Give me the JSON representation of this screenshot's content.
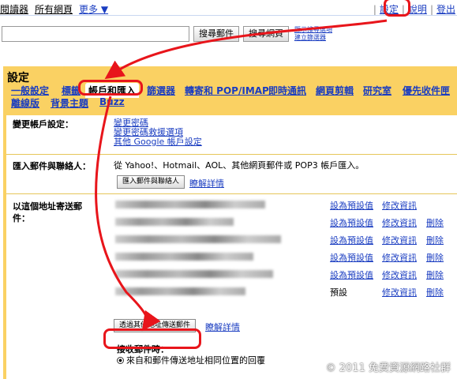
{
  "topbar": {
    "left_items": [
      "閱讀器",
      "所有網頁",
      "更多 ▼"
    ],
    "right_items": [
      "設定",
      "說明",
      "登出"
    ]
  },
  "search": {
    "value": "",
    "mail_button": "搜尋郵件",
    "web_button": "搜尋網頁",
    "options": [
      "顯示搜尋選項",
      "建立篩選器"
    ]
  },
  "settings": {
    "title": "設定",
    "tabs": [
      "一般設定",
      "標籤",
      "帳戶和匯入",
      "篩選器",
      "轉寄和 POP/IMAP",
      "即時通訊",
      "網頁剪輯",
      "研究室",
      "優先收件匣",
      "離線版",
      "背景主題",
      "Buzz"
    ],
    "change_account": {
      "label": "變更帳戶設定：",
      "links": [
        "變更密碼",
        "變更密碼救援選項",
        "其他 Google 帳戶設定"
      ]
    },
    "import": {
      "label": "匯入郵件與聯絡人：",
      "text": "從 Yahoo!、Hotmail、AOL、其他網頁郵件或 POP3 帳戶匯入。",
      "button": "匯入郵件與聯絡人",
      "learn_more": "瞭解詳情"
    },
    "send_as": {
      "label_line1": "以這個地址寄送郵",
      "label_line2": "件：",
      "rows": [
        {
          "set_default": "設為預設值",
          "edit": "修改資訊",
          "delete": ""
        },
        {
          "set_default": "設為預設值",
          "edit": "修改資訊",
          "delete": "刪除"
        },
        {
          "set_default": "設為預設值",
          "edit": "修改資訊",
          "delete": "刪除"
        },
        {
          "set_default": "設為預設值",
          "edit": "修改資訊",
          "delete": "刪除"
        },
        {
          "set_default": "設為預設值",
          "edit": "修改資訊",
          "delete": "刪除"
        },
        {
          "set_default": "預設",
          "edit": "修改資訊",
          "delete": "刪除"
        }
      ],
      "add_button": "透過其他地址傳送郵件",
      "learn_more": "瞭解詳情",
      "reply_label": "接收郵件時：",
      "reply_option": "來自和郵件傳送地址相同位置的回覆"
    }
  },
  "watermark": "© 2011 免費資源網路社群",
  "colors": {
    "panel": "#fad163",
    "link": "#1a3dc1",
    "annotation": "#e8151b"
  }
}
